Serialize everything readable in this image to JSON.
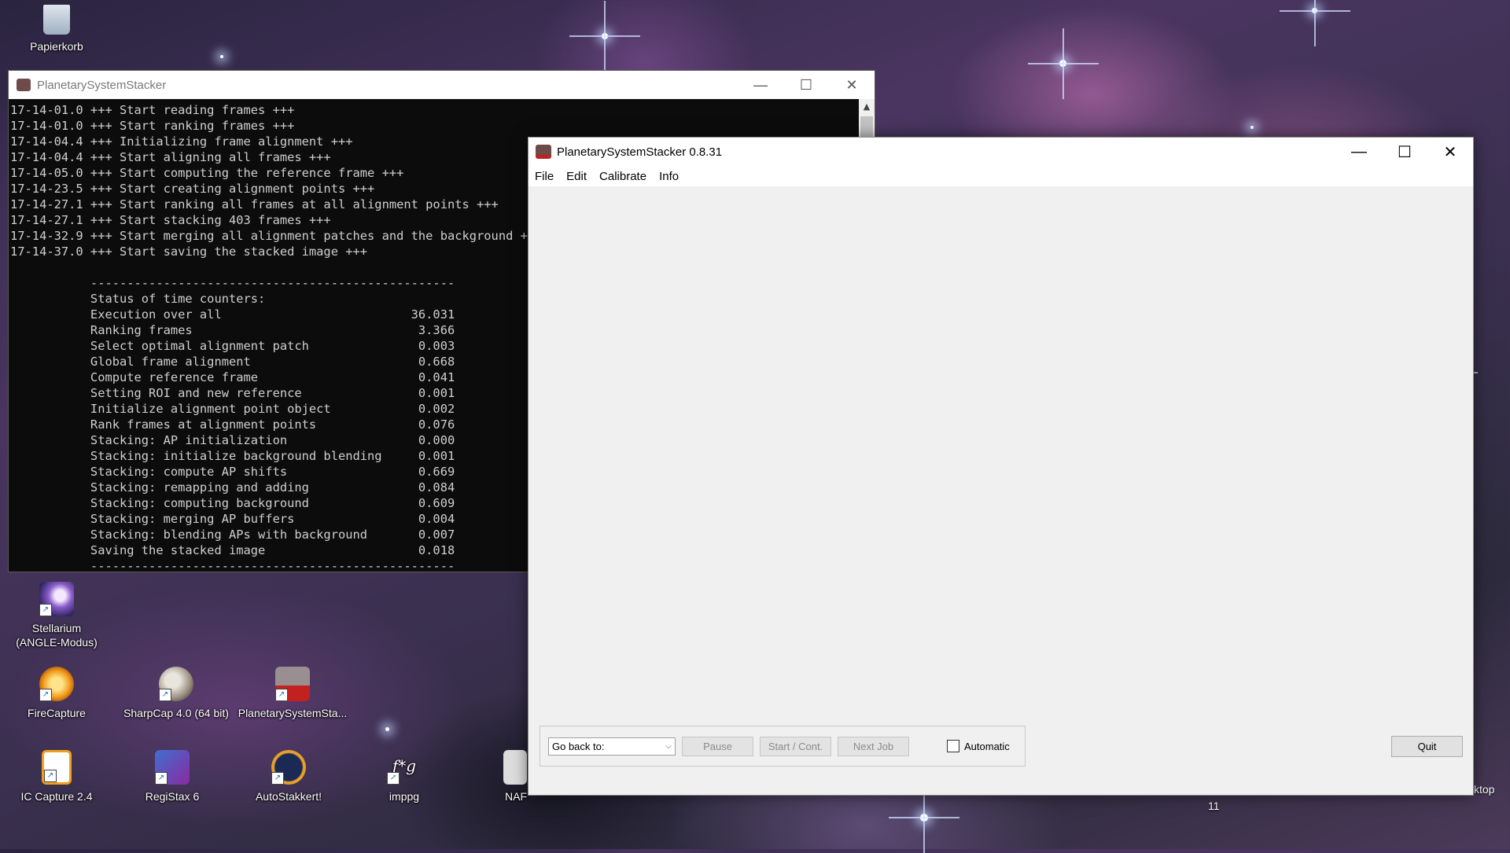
{
  "desktop": {
    "icons": [
      {
        "label": "Papierkorb",
        "icon": "recycle-bin-icon"
      },
      {
        "label": "Stellarium\n(ANGLE-Modus)",
        "icon": "stellarium-icon"
      },
      {
        "label": "FireCapture",
        "icon": "firecapture-icon"
      },
      {
        "label": "SharpCap 4.0 (64 bit)",
        "icon": "sharpcap-icon"
      },
      {
        "label": "PlanetarySystemSta...",
        "icon": "planetary-system-stacker-icon"
      },
      {
        "label": "IC Capture 2.4",
        "icon": "ic-capture-icon"
      },
      {
        "label": "RegiStax 6",
        "icon": "registax-icon"
      },
      {
        "label": "AutoStakkert!",
        "icon": "autostakkert-icon"
      },
      {
        "label": "imppg",
        "icon": "imppg-icon"
      },
      {
        "label": "NAF",
        "icon": "naf-icon"
      }
    ],
    "right_partial_text": "ktop",
    "bottom_number": "11"
  },
  "console_window": {
    "title": "PlanetarySystemStacker",
    "log": "17-14-01.0 +++ Start reading frames +++\n17-14-01.0 +++ Start ranking frames +++\n17-14-04.4 +++ Initializing frame alignment +++\n17-14-04.4 +++ Start aligning all frames +++\n17-14-05.0 +++ Start computing the reference frame +++\n17-14-23.5 +++ Start creating alignment points +++\n17-14-27.1 +++ Start ranking all frames at all alignment points +++\n17-14-27.1 +++ Start stacking 403 frames +++\n17-14-32.9 +++ Start merging all alignment patches and the background +++\n17-14-37.0 +++ Start saving the stacked image +++\n\n           --------------------------------------------------\n           Status of time counters:\n           Execution over all                          36.031\n           Ranking frames                               3.366\n           Select optimal alignment patch               0.003\n           Global frame alignment                       0.668\n           Compute reference frame                      0.041\n           Setting ROI and new reference                0.001\n           Initialize alignment point object            0.002\n           Rank frames at alignment points              0.076\n           Stacking: AP initialization                  0.000\n           Stacking: initialize background blending     0.001\n           Stacking: compute AP shifts                  0.669\n           Stacking: remapping and adding               0.084\n           Stacking: computing background               0.609\n           Stacking: merging AP buffers                 0.004\n           Stacking: blending APs with background       0.007\n           Saving the stacked image                     0.018\n           --------------------------------------------------"
  },
  "main_window": {
    "title": "PlanetarySystemStacker 0.8.31",
    "menu": [
      "File",
      "Edit",
      "Calibrate",
      "Info"
    ],
    "go_back_select": "Go back to:",
    "buttons": {
      "pause": "Pause",
      "start_cont": "Start / Cont.",
      "next_job": "Next Job",
      "quit": "Quit"
    },
    "automatic_label": "Automatic",
    "automatic_checked": false
  }
}
